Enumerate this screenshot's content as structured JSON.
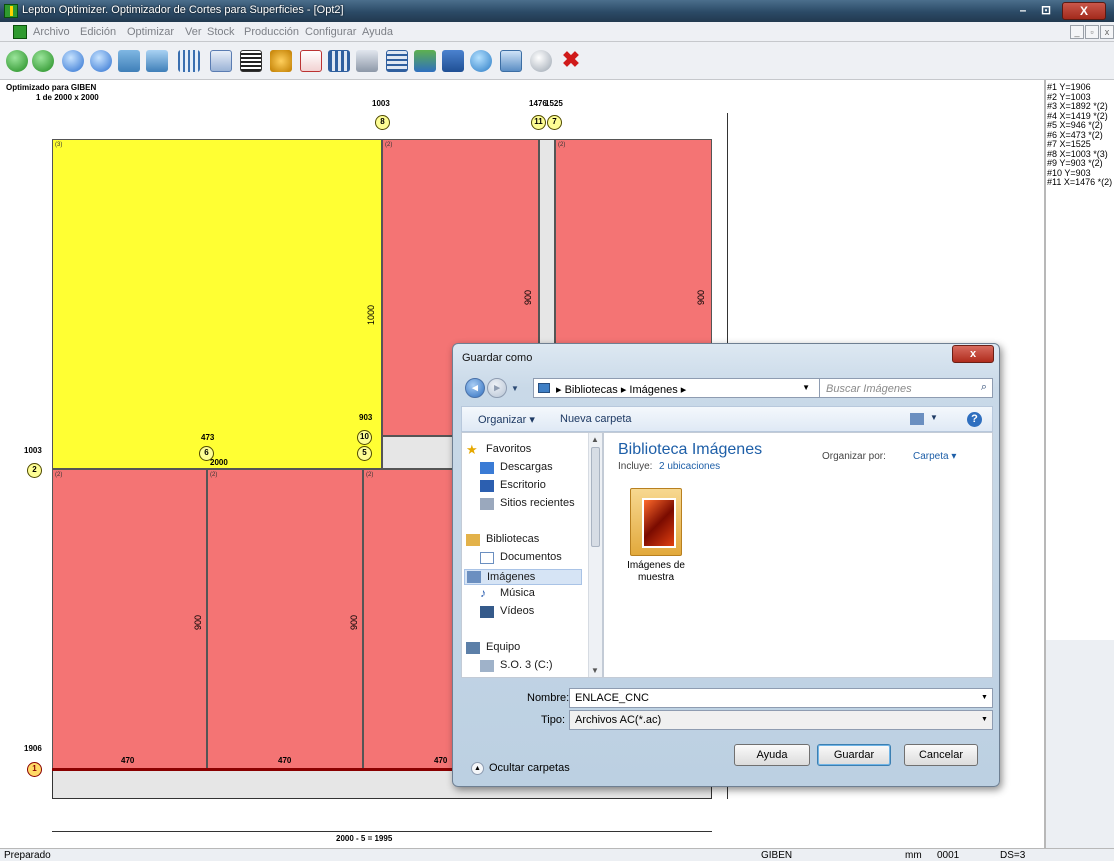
{
  "window": {
    "title": "Lepton Optimizer. Optimizador de Cortes para Superficies - [Opt2]",
    "min_symbol": "–",
    "max_symbol": "⊡",
    "close_symbol": "X"
  },
  "menu": {
    "items": [
      "Archivo",
      "Edición",
      "Optimizar",
      "Ver",
      "Stock",
      "Producción",
      "Configurar",
      "Ayuda"
    ]
  },
  "toolbar": {
    "icons": [
      "back-icon",
      "forward-icon",
      "zoom-in-icon",
      "zoom-out-icon",
      "rotate-icon",
      "edit-icon",
      "grid-icon",
      "panel-icon",
      "barcode-icon",
      "people-icon",
      "pdf-icon",
      "layout-icon",
      "print-icon",
      "table-icon",
      "export-icon",
      "save-icon",
      "refresh-icon",
      "calculator-icon",
      "disc-icon",
      "close-red-icon"
    ]
  },
  "layout": {
    "header_line1": "Optimizado para GIBEN",
    "header_line2": "1 de 2000 x 2000",
    "top_labels": [
      "1003",
      "1476",
      "1525"
    ],
    "markers": [
      "8",
      "11",
      "7",
      "10",
      "6",
      "5",
      "2",
      "1"
    ],
    "left_labels": [
      "1003",
      "1906"
    ],
    "mid_labels": [
      "473",
      "903",
      "2000"
    ],
    "piece_tags": [
      "(3)",
      "(2)"
    ],
    "dim_labels": [
      "1000",
      "900",
      "900",
      "900",
      "900"
    ],
    "bottom_dims": [
      "470",
      "470",
      "470"
    ],
    "width_label": "2000 - 5 = 1995"
  },
  "cut_list": [
    "#1 Y=1906",
    "#2 Y=1003",
    "#3 X=1892 *(2)",
    "#4 X=1419 *(2)",
    "#5 X=946 *(2)",
    "#6 X=473 *(2)",
    "#7 X=1525",
    "#8 X=1003 *(3)",
    "#9 Y=903 *(2)",
    "#10 Y=903",
    "#11 X=1476 *(2)"
  ],
  "status": {
    "left": "Preparado",
    "machine": "GIBEN",
    "unit": "mm",
    "code": "0001",
    "ds": "DS=3"
  },
  "dialog": {
    "title": "Guardar como",
    "close": "x",
    "address_parts": [
      "Bibliotecas",
      "Imágenes"
    ],
    "address": "▸ Bibliotecas ▸ Imágenes ▸",
    "search_placeholder": "Buscar Imágenes",
    "toolbar_organize": "Organizar ▾",
    "toolbar_new_folder": "Nueva carpeta",
    "nav": {
      "favorites": "Favoritos",
      "descargas": "Descargas",
      "escritorio": "Escritorio",
      "recientes": "Sitios recientes",
      "bibliotecas": "Bibliotecas",
      "documentos": "Documentos",
      "imagenes": "Imágenes",
      "musica": "Música",
      "videos": "Vídeos",
      "equipo": "Equipo",
      "so3": "S.O. 3 (C:)"
    },
    "library_title": "Biblioteca Imágenes",
    "library_includes_label": "Incluye:",
    "library_includes_link": "2 ubicaciones",
    "arrange_label": "Organizar por:",
    "arrange_value": "Carpeta ▾",
    "folder_label": "Imágenes de muestra",
    "filename_label": "Nombre:",
    "filename_value": "ENLACE_CNC",
    "type_label": "Tipo:",
    "type_value": "Archivos AC(*.ac)",
    "hide_folders": "Ocultar carpetas",
    "btn_help": "Ayuda",
    "btn_save": "Guardar",
    "btn_cancel": "Cancelar"
  }
}
